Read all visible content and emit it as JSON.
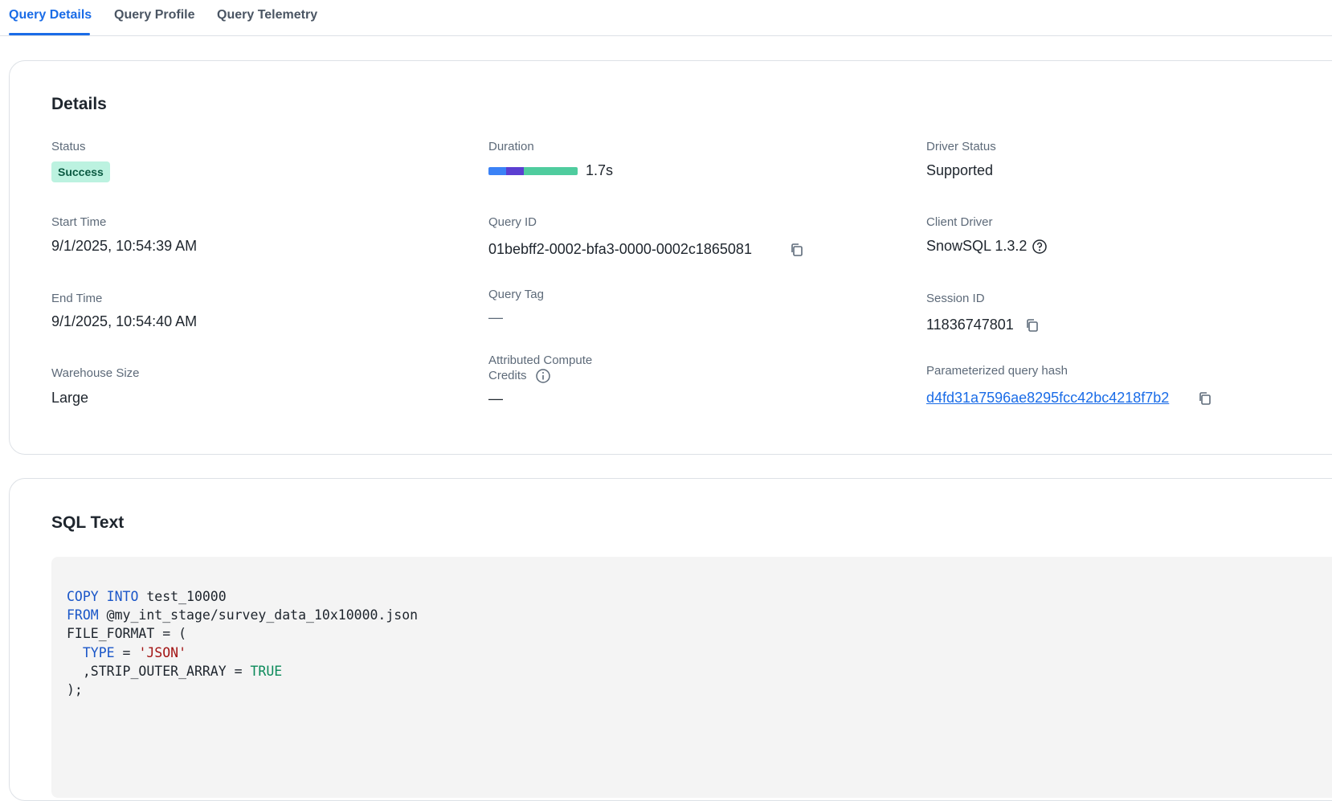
{
  "tabs": [
    {
      "label": "Query Details",
      "active": true
    },
    {
      "label": "Query Profile",
      "active": false
    },
    {
      "label": "Query Telemetry",
      "active": false
    }
  ],
  "details": {
    "title": "Details",
    "status": {
      "label": "Status",
      "value": "Success",
      "color": "#bcf2e0"
    },
    "start_time": {
      "label": "Start Time",
      "value": "9/1/2025, 10:54:39 AM"
    },
    "end_time": {
      "label": "End Time",
      "value": "9/1/2025, 10:54:40 AM"
    },
    "warehouse_size": {
      "label": "Warehouse Size",
      "value": "Large"
    },
    "duration": {
      "label": "Duration",
      "value": "1.7s",
      "segments": [
        {
          "fraction": 0.2,
          "color": "#3b82f6"
        },
        {
          "fraction": 0.2,
          "color": "#5b3fd1"
        },
        {
          "fraction": 0.6,
          "color": "#4fcc9e"
        }
      ]
    },
    "query_id": {
      "label": "Query ID",
      "value": "01bebff2-0002-bfa3-0000-0002c1865081",
      "icon": "copy-icon"
    },
    "query_tag": {
      "label": "Query Tag",
      "value": "—"
    },
    "attributed_credits": {
      "label_line1": "Attributed Compute",
      "label_line2": "Credits",
      "value": "—",
      "icon": "info-icon"
    },
    "driver_status": {
      "label": "Driver Status",
      "value": "Supported"
    },
    "client_driver": {
      "label": "Client Driver",
      "value": "SnowSQL 1.3.2",
      "icon": "help-icon"
    },
    "session_id": {
      "label": "Session ID",
      "value": "11836747801",
      "icon": "copy-icon"
    },
    "param_hash": {
      "label": "Parameterized query hash",
      "value": "d4fd31a7596ae8295fcc42bc4218f7b2",
      "icon": "copy-icon"
    }
  },
  "sql": {
    "title": "SQL Text",
    "lines": [
      [
        {
          "t": "COPY INTO",
          "c": "kw"
        },
        {
          "t": " test_10000",
          "c": ""
        }
      ],
      [
        {
          "t": "FROM",
          "c": "kw"
        },
        {
          "t": " @my_int_stage/survey_data_10x10000.json",
          "c": ""
        }
      ],
      [
        {
          "t": "FILE_FORMAT = (",
          "c": ""
        }
      ],
      [
        {
          "t": "  ",
          "c": ""
        },
        {
          "t": "TYPE",
          "c": "kw"
        },
        {
          "t": " = ",
          "c": ""
        },
        {
          "t": "'JSON'",
          "c": "str"
        }
      ],
      [
        {
          "t": "  ,STRIP_OUTER_ARRAY = ",
          "c": ""
        },
        {
          "t": "TRUE",
          "c": "bool"
        }
      ],
      [
        {
          "t": ");",
          "c": ""
        }
      ]
    ]
  }
}
